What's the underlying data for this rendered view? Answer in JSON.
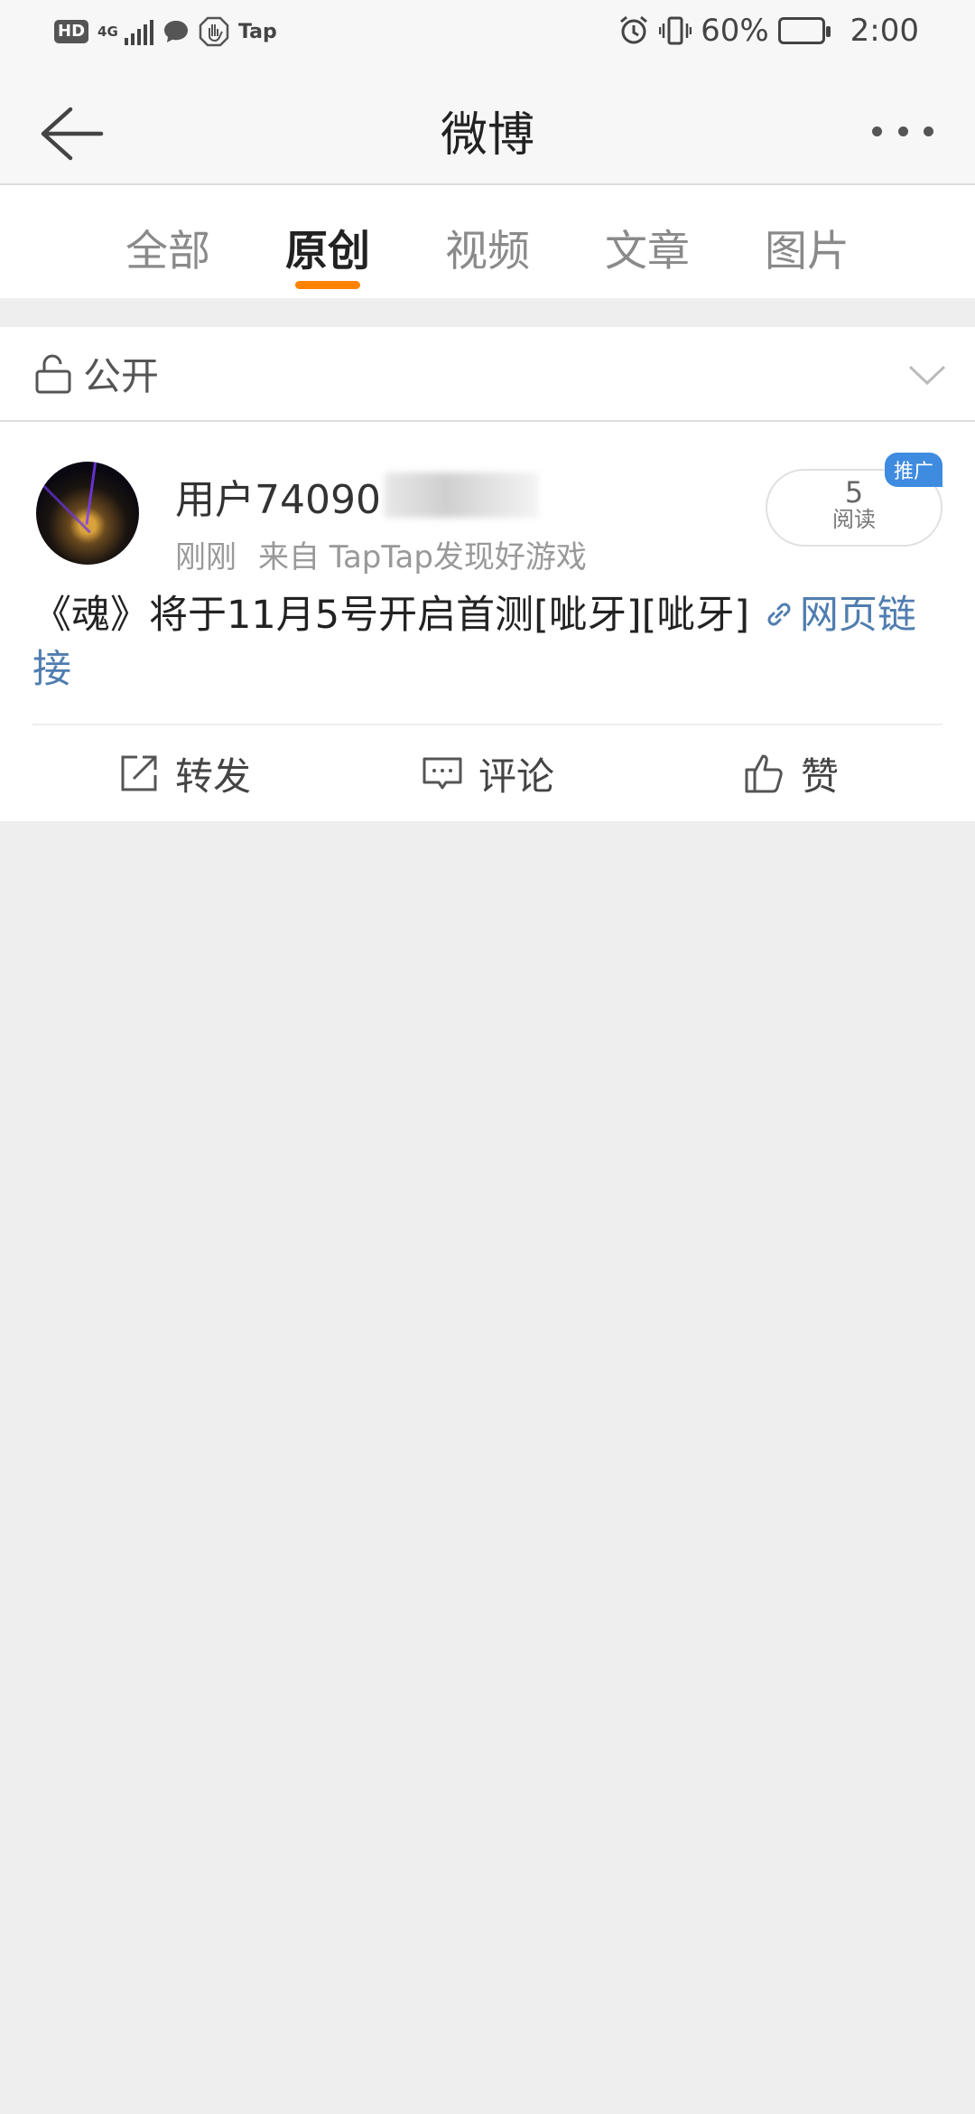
{
  "status_bar": {
    "hd": "HD",
    "network": "4G",
    "app_badge": "Tap",
    "battery_pct": "60%",
    "battery_level": 0.6,
    "time": "2:00"
  },
  "nav": {
    "title": "微博"
  },
  "tabs": [
    {
      "label": "全部",
      "active": false
    },
    {
      "label": "原创",
      "active": true
    },
    {
      "label": "视频",
      "active": false
    },
    {
      "label": "文章",
      "active": false
    },
    {
      "label": "图片",
      "active": false
    }
  ],
  "visibility": {
    "label": "公开"
  },
  "post": {
    "username": "用户74090",
    "time": "刚刚",
    "source": "来自 TapTap发现好游戏",
    "read_count": "5",
    "read_label": "阅读",
    "ad_label": "推广",
    "text": "《魂》将于11月5号开启首测[呲牙][呲牙] ",
    "link_text": "网页链接"
  },
  "actions": {
    "repost": "转发",
    "comment": "评论",
    "like": "赞"
  },
  "colors": {
    "accent": "#ff8200",
    "link": "#507daf",
    "ad_badge": "#3e8be0"
  }
}
